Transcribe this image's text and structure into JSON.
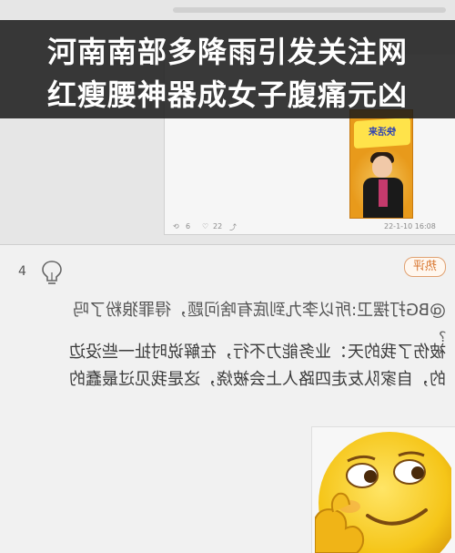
{
  "headline": {
    "line1": "河南南部多降雨引发关注网",
    "line2": "红瘦腰神器成女子腹痛元凶"
  },
  "top_post": {
    "poster_title": "快活来",
    "stats": {
      "timestamp": "22-1-10 16:08",
      "likes": "22",
      "comments": "6"
    }
  },
  "comment": {
    "badge": "热评",
    "likes": "4",
    "lines": [
      "@BG打摆卫:所以李九到底有啥问题，得罪狼粉了吗",
      "?",
      "被伤了我的天：业务能力不行，在解说时扯一些没边",
      "的，自家队友走四路人上会被烧，这是我见过最蠢的"
    ]
  },
  "icons": {
    "bulb": "lightbulb-icon",
    "emoji": "smirk-emoji-icon"
  },
  "colors": {
    "banner": "#1a1a1a",
    "badge": "#d8742c",
    "emoji_yellow": "#f5c518"
  }
}
